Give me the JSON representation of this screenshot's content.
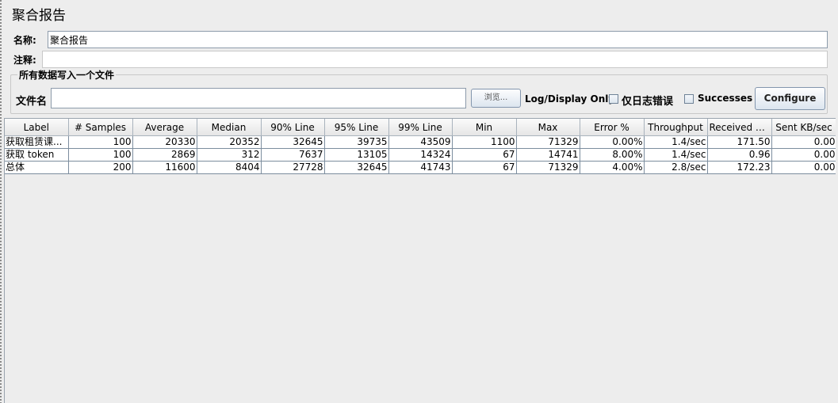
{
  "panel": {
    "title": "聚合报告"
  },
  "name_field": {
    "label": "名称:",
    "value": "聚合报告"
  },
  "comment_field": {
    "label": "注释:",
    "value": ""
  },
  "file_group": {
    "title": "所有数据写入一个文件",
    "filename_label": "文件名",
    "filename_value": "",
    "browse_label": "浏览...",
    "log_display_label": "Log/Display Only:",
    "errors_only_label": "仅日志错误",
    "errors_only_checked": false,
    "successes_label": "Successes",
    "successes_checked": false,
    "configure_label": "Configure"
  },
  "table": {
    "columns": [
      "Label",
      "# Samples",
      "Average",
      "Median",
      "90% Line",
      "95% Line",
      "99% Line",
      "Min",
      "Max",
      "Error %",
      "Throughput",
      "Received KB...",
      "Sent KB/sec"
    ],
    "rows": [
      [
        "获取租赁课...",
        "100",
        "20330",
        "20352",
        "32645",
        "39735",
        "43509",
        "1100",
        "71329",
        "0.00%",
        "1.4/sec",
        "171.50",
        "0.00"
      ],
      [
        "获取 token",
        "100",
        "2869",
        "312",
        "7637",
        "13105",
        "14324",
        "67",
        "14741",
        "8.00%",
        "1.4/sec",
        "0.96",
        "0.00"
      ],
      [
        "总体",
        "200",
        "11600",
        "8404",
        "27728",
        "32645",
        "41743",
        "67",
        "71329",
        "4.00%",
        "2.8/sec",
        "172.23",
        "0.00"
      ]
    ]
  }
}
